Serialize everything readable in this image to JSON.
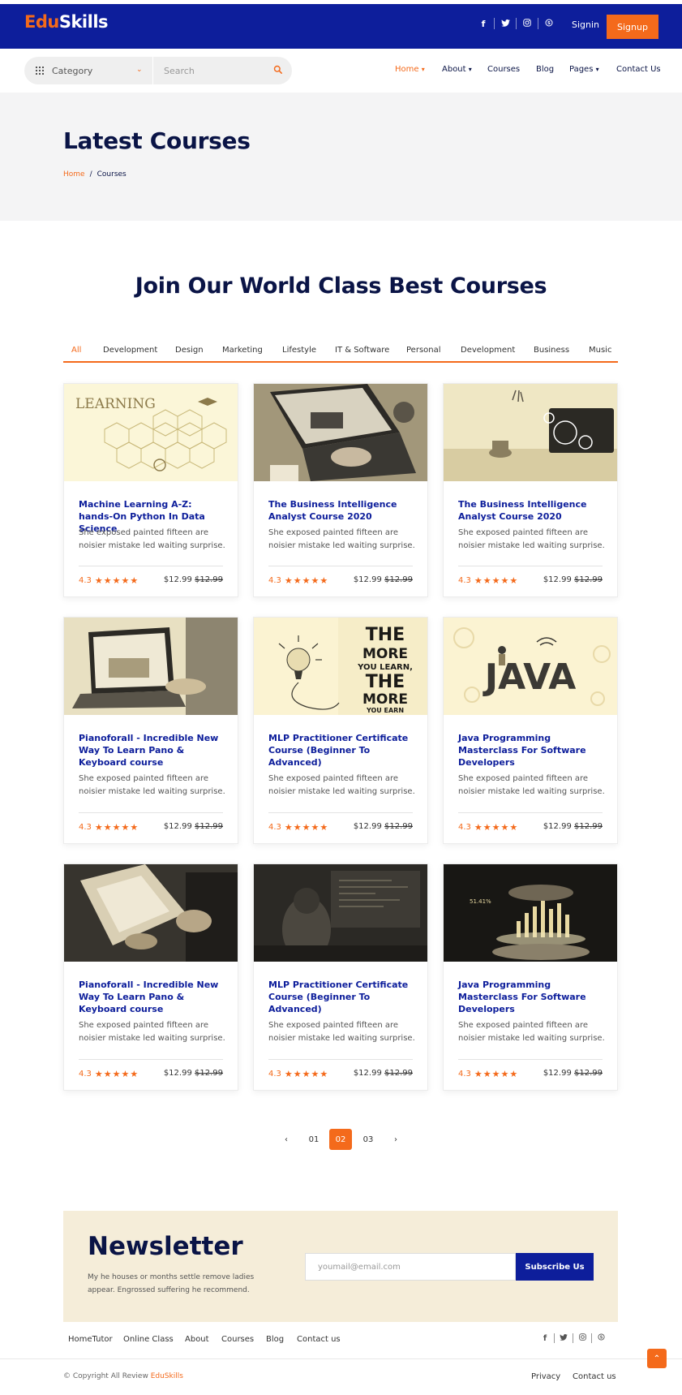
{
  "brand": {
    "part1": "Edu",
    "part2": "Skills"
  },
  "topbar": {
    "social": [
      "facebook-icon",
      "twitter-icon",
      "instagram-icon",
      "skype-icon"
    ],
    "signin": "Signin",
    "signup": "Signup"
  },
  "navbar": {
    "category": "Category",
    "search_placeholder": "Search",
    "menu": [
      {
        "label": "Home",
        "dropdown": true,
        "active": true
      },
      {
        "label": "About",
        "dropdown": true
      },
      {
        "label": "Courses"
      },
      {
        "label": "Blog"
      },
      {
        "label": "Pages",
        "dropdown": true
      },
      {
        "label": "Contact Us"
      }
    ]
  },
  "banner": {
    "title": "Latest Courses",
    "breadcrumb": {
      "home": "Home",
      "sep": "/",
      "current": "Courses"
    }
  },
  "section_title": "Join Our World Class Best Courses",
  "tabs": [
    "All",
    "Development",
    "Design",
    "Marketing",
    "Lifestyle",
    "IT & Software",
    "Personal",
    "Development",
    "Business",
    "Music"
  ],
  "courses": [
    {
      "title": "Machine Learning A-Z: hands-On Python In Data Science",
      "desc": "She exposed painted fifteen are noisier mistake led waiting surprise.",
      "rating": "4.3",
      "price": "$12.99",
      "old_price": "$12.99",
      "image": "learning-hexagons"
    },
    {
      "title": "The Business Intelligence Analyst Course 2020",
      "desc": "She exposed painted fifteen are noisier mistake led waiting surprise.",
      "rating": "4.3",
      "price": "$12.99",
      "old_price": "$12.99",
      "image": "laptop-online-education"
    },
    {
      "title": "The Business Intelligence Analyst Course 2020",
      "desc": "She exposed painted fifteen are noisier mistake led waiting surprise.",
      "rating": "4.3",
      "price": "$12.99",
      "old_price": "$12.99",
      "image": "laptop-desk-icons"
    },
    {
      "title": "Pianoforall - Incredible New Way To Learn Pano & Keyboard course",
      "desc": "She exposed painted fifteen are noisier mistake led waiting surprise.",
      "rating": "4.3",
      "price": "$12.99",
      "old_price": "$12.99",
      "image": "e-learning-laptop"
    },
    {
      "title": "MLP Practitioner Certificate Course (Beginner To Advanced)",
      "desc": "She exposed painted fifteen are noisier mistake led waiting surprise.",
      "rating": "4.3",
      "price": "$12.99",
      "old_price": "$12.99",
      "image": "the-more-you-learn"
    },
    {
      "title": "Java Programming Masterclass For Software Developers",
      "desc": "She exposed painted fifteen are noisier mistake led waiting surprise.",
      "rating": "4.3",
      "price": "$12.99",
      "old_price": "$12.99",
      "image": "java-illustration"
    },
    {
      "title": "Pianoforall - Incredible New Way To Learn Pano & Keyboard course",
      "desc": "She exposed painted fifteen are noisier mistake led waiting surprise.",
      "rating": "4.3",
      "price": "$12.99",
      "old_price": "$12.99",
      "image": "hands-documents"
    },
    {
      "title": "MLP Practitioner Certificate Course (Beginner To Advanced)",
      "desc": "She exposed painted fifteen are noisier mistake led waiting surprise.",
      "rating": "4.3",
      "price": "$12.99",
      "old_price": "$12.99",
      "image": "coder-dark-room"
    },
    {
      "title": "Java Programming Masterclass For Software Developers",
      "desc": "She exposed painted fifteen are noisier mistake led waiting surprise.",
      "rating": "4.3",
      "price": "$12.99",
      "old_price": "$12.99",
      "image": "holographic-chart"
    }
  ],
  "pagination": {
    "pages": [
      "01",
      "02",
      "03"
    ],
    "active": "02"
  },
  "newsletter": {
    "title": "Newsletter",
    "text": "My he houses or months settle remove ladies appear. Engrossed suffering he recommend.",
    "email_placeholder": "youmail@email.com",
    "button": "Subscribe Us"
  },
  "footer": {
    "links": [
      "HomeTutor",
      "Online Class",
      "About",
      "Courses",
      "Blog",
      "Contact us"
    ],
    "social": [
      "facebook-icon",
      "twitter-icon",
      "instagram-icon",
      "skype-icon"
    ],
    "copyright_prefix": "© Copyright All Review ",
    "copyright_brand": "EduSkills",
    "bottom_links": [
      "Privacy",
      "Contact us"
    ]
  },
  "colors": {
    "primary": "#0d1e9b",
    "accent": "#f46a1b",
    "heading": "#0a1446",
    "banner_bg": "#f4f4f5",
    "newsletter_bg": "#f5edd9"
  }
}
